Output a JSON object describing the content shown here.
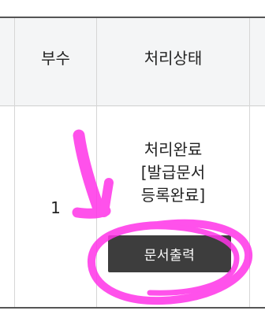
{
  "table": {
    "headers": {
      "copies": "부수",
      "status": "처리상태"
    },
    "row": {
      "copies": "1",
      "status_lines": [
        "처리완료",
        "[발급문서",
        "등록완료]"
      ],
      "print_button": "문서출력"
    }
  },
  "annotation": {
    "color": "#ff33e8"
  }
}
